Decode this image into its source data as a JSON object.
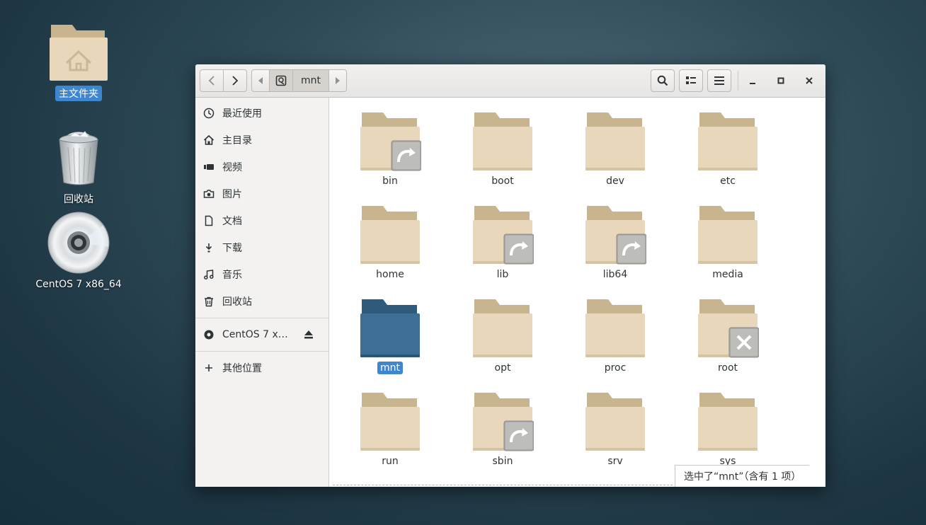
{
  "desktop": {
    "home_label": "主文件夹",
    "trash_label": "回收站",
    "disc_label": "CentOS 7 x86_64"
  },
  "toolbar": {
    "path_segment": "mnt"
  },
  "sidebar": {
    "items": [
      {
        "label": "最近使用",
        "icon": "clock-icon"
      },
      {
        "label": "主目录",
        "icon": "home-icon"
      },
      {
        "label": "视频",
        "icon": "video-icon"
      },
      {
        "label": "图片",
        "icon": "camera-icon"
      },
      {
        "label": "文档",
        "icon": "document-icon"
      },
      {
        "label": "下载",
        "icon": "download-icon"
      },
      {
        "label": "音乐",
        "icon": "music-icon"
      },
      {
        "label": "回收站",
        "icon": "trash-icon"
      }
    ],
    "device_label": "CentOS 7 x…",
    "other_label": "其他位置"
  },
  "files": [
    {
      "name": "bin",
      "badge": "link"
    },
    {
      "name": "boot",
      "badge": ""
    },
    {
      "name": "dev",
      "badge": ""
    },
    {
      "name": "etc",
      "badge": ""
    },
    {
      "name": "home",
      "badge": ""
    },
    {
      "name": "lib",
      "badge": "link"
    },
    {
      "name": "lib64",
      "badge": "link"
    },
    {
      "name": "media",
      "badge": ""
    },
    {
      "name": "mnt",
      "badge": "",
      "selected": true
    },
    {
      "name": "opt",
      "badge": ""
    },
    {
      "name": "proc",
      "badge": ""
    },
    {
      "name": "root",
      "badge": "no-access"
    },
    {
      "name": "run",
      "badge": ""
    },
    {
      "name": "sbin",
      "badge": "link"
    },
    {
      "name": "srv",
      "badge": ""
    },
    {
      "name": "sys",
      "badge": ""
    }
  ],
  "status": {
    "text": "选中了“mnt”（含有 1 项）"
  },
  "colors": {
    "accent": "#3d86d0",
    "folder": "#e9d7bb",
    "folder_back": "#c8b590",
    "folder_selected": "#3d6e94"
  }
}
